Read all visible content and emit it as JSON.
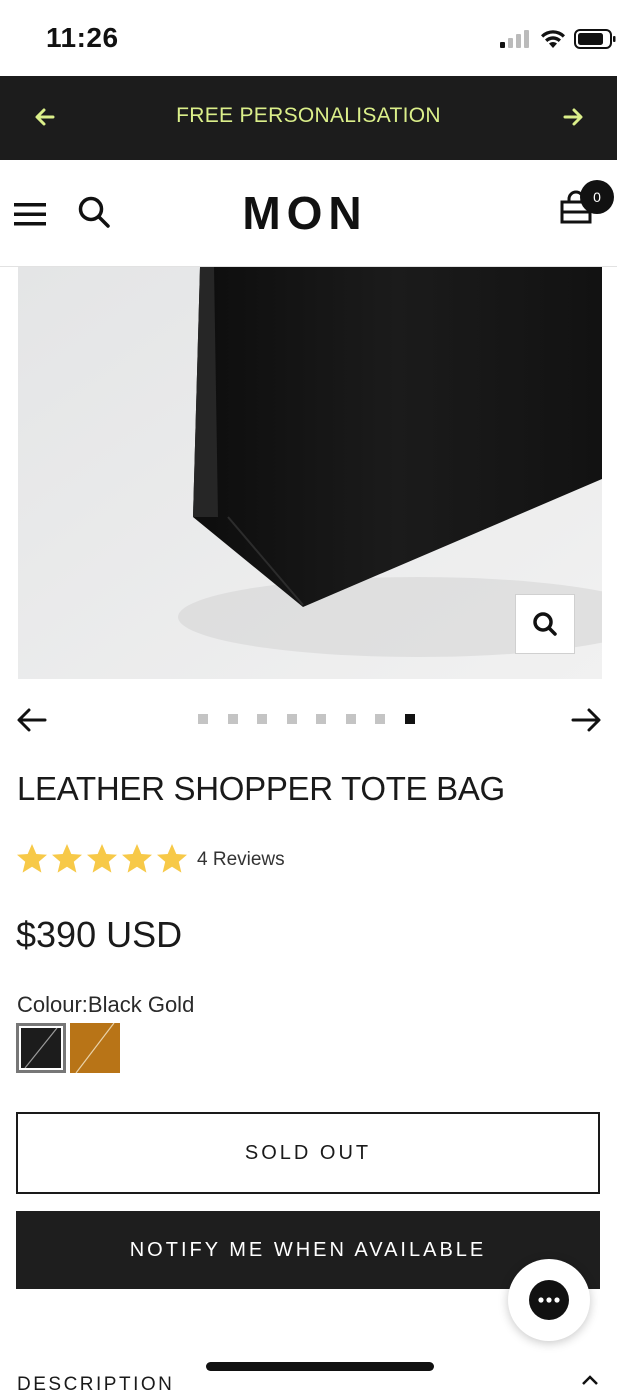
{
  "status_bar": {
    "time": "11:26"
  },
  "announcement": {
    "text": "FREE PERSONALISATION"
  },
  "header": {
    "logo": "MON",
    "cart_count": "0"
  },
  "carousel": {
    "slide_count": 8,
    "active_index": 7
  },
  "product": {
    "title": "LEATHER SHOPPER TOTE BAG",
    "rating": 5,
    "reviews": "4 Reviews",
    "price": "$390 USD",
    "colour_label": "Colour:Black Gold",
    "swatches": [
      {
        "name": "black-gold",
        "color": "#1c1c1c",
        "selected": true
      },
      {
        "name": "tan",
        "color": "#b87417",
        "selected": false
      }
    ]
  },
  "buttons": {
    "sold_out": "SOLD OUT",
    "notify": "NOTIFY ME WHEN AVAILABLE"
  },
  "description": {
    "heading": "DESCRIPTION"
  },
  "colors": {
    "announcement_bg": "#1c1c1c",
    "announcement_text": "#dbef8a",
    "star": "#f7c948",
    "dark": "#1e1e1e"
  }
}
